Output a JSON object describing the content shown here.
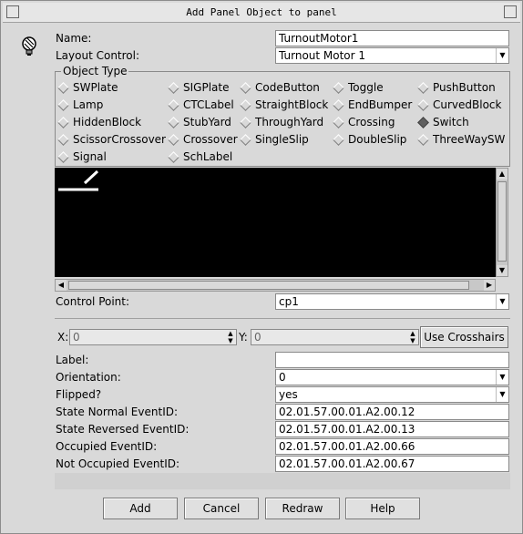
{
  "window": {
    "title": "Add Panel Object to panel",
    "app_icon": "jmri-lightbulb-icon"
  },
  "form": {
    "name_label": "Name:",
    "name_value": "TurnoutMotor1",
    "layout_control_label": "Layout Control:",
    "layout_control_value": "Turnout Motor 1",
    "object_type_legend": "Object Type",
    "object_types": [
      {
        "label": "SWPlate",
        "selected": false
      },
      {
        "label": "SIGPlate",
        "selected": false
      },
      {
        "label": "CodeButton",
        "selected": false
      },
      {
        "label": "Toggle",
        "selected": false
      },
      {
        "label": "PushButton",
        "selected": false
      },
      {
        "label": "Lamp",
        "selected": false
      },
      {
        "label": "CTCLabel",
        "selected": false
      },
      {
        "label": "StraightBlock",
        "selected": false
      },
      {
        "label": "EndBumper",
        "selected": false
      },
      {
        "label": "CurvedBlock",
        "selected": false
      },
      {
        "label": "HiddenBlock",
        "selected": false
      },
      {
        "label": "StubYard",
        "selected": false
      },
      {
        "label": "ThroughYard",
        "selected": false
      },
      {
        "label": "Crossing",
        "selected": false
      },
      {
        "label": "Switch",
        "selected": true
      },
      {
        "label": "ScissorCrossover",
        "selected": false
      },
      {
        "label": "Crossover",
        "selected": false
      },
      {
        "label": "SingleSlip",
        "selected": false
      },
      {
        "label": "DoubleSlip",
        "selected": false
      },
      {
        "label": "ThreeWaySW",
        "selected": false
      },
      {
        "label": "Signal",
        "selected": false
      },
      {
        "label": "SchLabel",
        "selected": false
      }
    ],
    "control_point_label": "Control Point:",
    "control_point_value": "cp1",
    "x_label": "X:",
    "x_value": "0",
    "y_label": "Y:",
    "y_value": "0",
    "use_crosshairs_label": "Use Crosshairs",
    "label_label": "Label:",
    "label_value": "",
    "orientation_label": "Orientation:",
    "orientation_value": "0",
    "flipped_label": "Flipped?",
    "flipped_value": "yes",
    "state_normal_label": "State Normal EventID:",
    "state_normal_value": "02.01.57.00.01.A2.00.12",
    "state_reversed_label": "State Reversed EventID:",
    "state_reversed_value": "02.01.57.00.01.A2.00.13",
    "occupied_label": "Occupied EventID:",
    "occupied_value": "02.01.57.00.01.A2.00.66",
    "not_occupied_label": "Not Occupied EventID:",
    "not_occupied_value": "02.01.57.00.01.A2.00.67"
  },
  "buttons": {
    "add": "Add",
    "cancel": "Cancel",
    "redraw": "Redraw",
    "help": "Help"
  },
  "colors": {
    "preview_bg": "#000000",
    "preview_stroke": "#ffffff"
  }
}
